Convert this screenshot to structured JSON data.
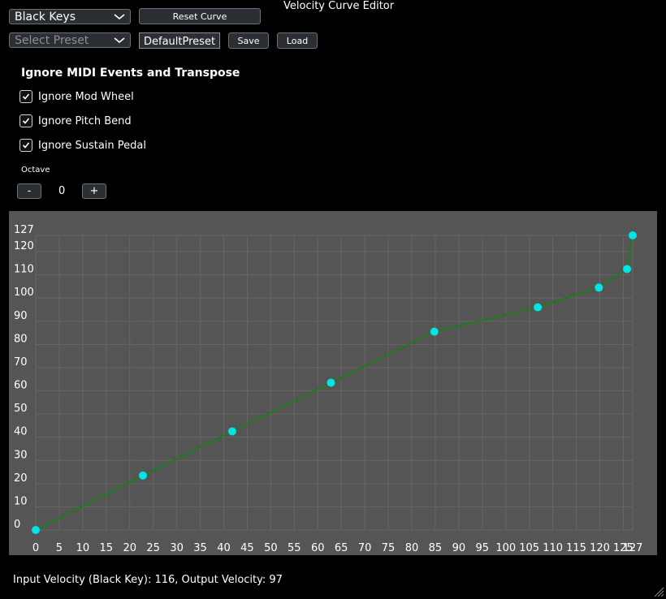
{
  "window_title": "Velocity Curve Editor",
  "key_select": {
    "value": "Black Keys",
    "icon": "chevron-down-icon"
  },
  "reset_button_label": "Reset Curve",
  "preset_select": {
    "placeholder": "Select Preset",
    "icon": "chevron-down-icon"
  },
  "preset_name_input": {
    "value": "DefaultPreset"
  },
  "save_label": "Save",
  "load_label": "Load",
  "ignore_section": {
    "title": "Ignore MIDI Events and Transpose",
    "options": [
      {
        "label": "Ignore Mod Wheel",
        "checked": true
      },
      {
        "label": "Ignore Pitch Bend",
        "checked": true
      },
      {
        "label": "Ignore Sustain Pedal",
        "checked": true
      }
    ]
  },
  "octave": {
    "label": "Octave",
    "minus_label": "-",
    "plus_label": "+",
    "value": "0"
  },
  "status_text": "Input Velocity (Black Key): 116, Output Velocity: 97",
  "colors": {
    "background": "#000000",
    "plot_background": "#555555",
    "grid": "#666666",
    "curve": "#1e7a1e",
    "points": "#00e5e5",
    "control_bg": "#2b2f33",
    "control_border": "#6b7075"
  },
  "chart_data": {
    "type": "line",
    "x": [
      0,
      22.8,
      41.8,
      62.8,
      84.8,
      106.8,
      119.8,
      125.8,
      127
    ],
    "y": [
      0,
      23.5,
      42.5,
      63.5,
      85.5,
      96.0,
      104.5,
      112.5,
      127
    ],
    "xlim": [
      0,
      127
    ],
    "ylim": [
      0,
      127
    ],
    "x_ticks": [
      0,
      5,
      10,
      15,
      20,
      25,
      30,
      35,
      40,
      45,
      50,
      55,
      60,
      65,
      70,
      75,
      80,
      85,
      90,
      95,
      100,
      105,
      110,
      115,
      120,
      125,
      127
    ],
    "y_ticks": [
      0,
      10,
      20,
      30,
      40,
      50,
      60,
      70,
      80,
      90,
      100,
      110,
      120,
      127
    ],
    "grid": true,
    "title": "",
    "xlabel": "",
    "ylabel": ""
  }
}
